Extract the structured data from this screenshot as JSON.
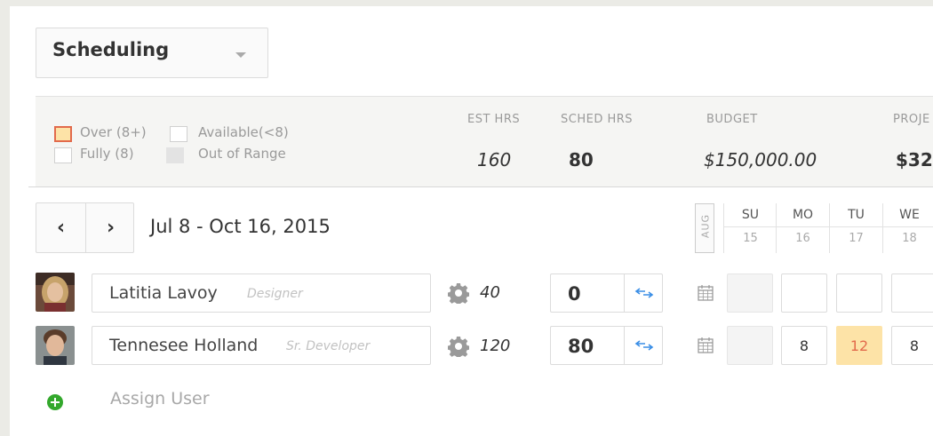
{
  "header": {
    "view_select": "Scheduling"
  },
  "legend": {
    "over": "Over (8+)",
    "available": "Available(<8)",
    "fully": "Fully (8)",
    "out_of_range": "Out of Range",
    "colors": {
      "over_fill": "#fde3a7",
      "over_border": "#e26a4b",
      "out_of_range": "#e3e3e3"
    }
  },
  "stats": {
    "est_hrs": {
      "label": "EST HRS",
      "value": "160"
    },
    "sched_hrs": {
      "label": "SCHED HRS",
      "value": "80"
    },
    "budget": {
      "label": "BUDGET",
      "value": "$150,000.00"
    },
    "projected": {
      "label": "PROJE",
      "value": "$32"
    }
  },
  "nav": {
    "prev": "‹",
    "next": "›",
    "date_range": "Jul 8 - Oct 16, 2015"
  },
  "calendar": {
    "month": "AUG",
    "days": [
      {
        "name": "SU",
        "num": "15"
      },
      {
        "name": "MO",
        "num": "16"
      },
      {
        "name": "TU",
        "num": "17"
      },
      {
        "name": "WE",
        "num": "18"
      }
    ]
  },
  "users": [
    {
      "name": "Latitia Lavoy",
      "role": "Designer",
      "est_hours": "40",
      "scheduled": "0",
      "cells": [
        "",
        "",
        "",
        ""
      ]
    },
    {
      "name": "Tennesee Holland",
      "role": "Sr. Developer",
      "est_hours": "120",
      "scheduled": "80",
      "cells": [
        "",
        "8",
        "12",
        "8"
      ]
    }
  ],
  "assign": {
    "label": "Assign User"
  }
}
